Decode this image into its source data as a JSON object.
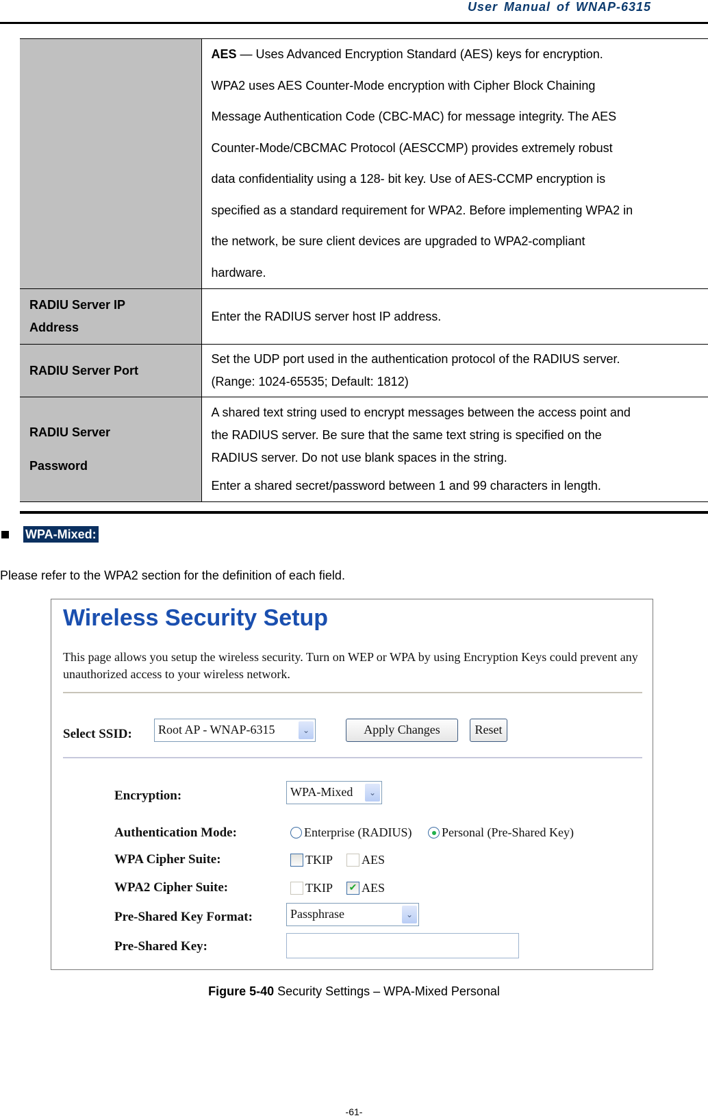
{
  "header": {
    "title": "User  Manual  of  WNAP-6315"
  },
  "table": {
    "rows": [
      {
        "term": "",
        "desc_bold": "AES",
        "desc_lines": [
          " — Uses Advanced Encryption Standard (AES) keys for encryption.",
          "WPA2 uses AES Counter-Mode encryption with Cipher Block Chaining",
          "Message Authentication Code (CBC-MAC) for message integrity. The AES",
          "Counter-Mode/CBCMAC Protocol (AESCCMP) provides extremely robust",
          "data confidentiality using a 128- bit key. Use of AES-CCMP encryption is",
          "specified as a standard requirement for WPA2. Before implementing WPA2 in",
          "the network, be sure client devices are upgraded to WPA2-compliant",
          "hardware."
        ]
      },
      {
        "term_lines": [
          "RADIU Server IP",
          "Address"
        ],
        "desc_lines": [
          "Enter the RADIUS server host IP address."
        ]
      },
      {
        "term_lines": [
          "RADIU Server Port"
        ],
        "desc_lines": [
          "Set the UDP port used in the authentication protocol of the RADIUS server.",
          "(Range: 1024-65535; Default: 1812)"
        ]
      },
      {
        "term_lines": [
          "RADIU Server",
          "Password"
        ],
        "desc_lines": [
          "A shared text string used to encrypt messages between the access point and",
          "the RADIUS server. Be sure that the same text string is specified on the",
          "RADIUS server. Do not use blank spaces in the string.",
          "Enter a shared secret/password between 1 and 99 characters in length."
        ]
      }
    ]
  },
  "section": {
    "bullet_icon": "square-bullet",
    "label": "WPA-Mixed:",
    "intro": "Please refer to the WPA2 section for the definition of each field."
  },
  "figure": {
    "title": "Wireless Security Setup",
    "description": "This page allows you setup the wireless security. Turn on WEP or WPA by using Encryption Keys could prevent any unauthorized access to your wireless network.",
    "ssid": {
      "label": "Select SSID:",
      "value": "Root AP - WNAP-6315"
    },
    "apply_button": "Apply Changes",
    "reset_button": "Reset",
    "encryption": {
      "label": "Encryption:",
      "value": "WPA-Mixed"
    },
    "auth_mode": {
      "label": "Authentication Mode:",
      "options": [
        {
          "label": "Enterprise (RADIUS)",
          "selected": false
        },
        {
          "label": "Personal (Pre-Shared Key)",
          "selected": true
        }
      ]
    },
    "wpa_cipher": {
      "label": "WPA Cipher Suite:",
      "options": [
        {
          "label": "TKIP",
          "checked": false
        },
        {
          "label": "AES",
          "checked": false
        }
      ]
    },
    "wpa2_cipher": {
      "label": "WPA2 Cipher Suite:",
      "options": [
        {
          "label": "TKIP",
          "checked": false
        },
        {
          "label": "AES",
          "checked": true
        }
      ]
    },
    "psk_format": {
      "label": "Pre-Shared Key Format:",
      "value": "Passphrase"
    },
    "psk": {
      "label": "Pre-Shared Key:",
      "value": ""
    },
    "check_glyph": "✔",
    "dropdown_glyph": "⌄"
  },
  "caption": {
    "bold": "Figure 5-40",
    "text": " Security Settings – WPA-Mixed Personal"
  },
  "footer": {
    "page_number": "-61-"
  }
}
